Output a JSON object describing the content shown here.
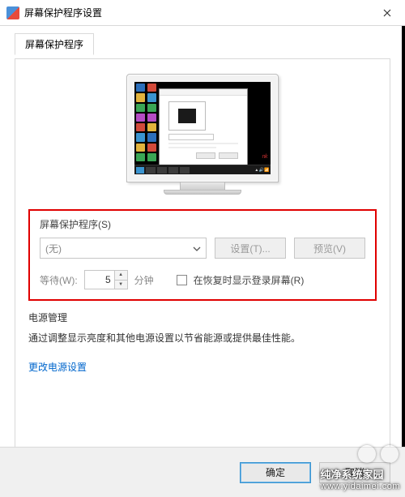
{
  "window": {
    "title": "屏幕保护程序设置"
  },
  "tab": {
    "label": "屏幕保护程序"
  },
  "screensaver": {
    "group_label": "屏幕保护程序(S)",
    "selected": "(无)",
    "settings_btn": "设置(T)...",
    "preview_btn": "预览(V)",
    "wait_label": "等待(W):",
    "wait_value": "5",
    "wait_unit": "分钟",
    "resume_checkbox": "在恢复时显示登录屏幕(R)"
  },
  "power": {
    "group_label": "电源管理",
    "desc": "通过调整显示亮度和其他电源设置以节省能源或提供最佳性能。",
    "link": "更改电源设置"
  },
  "footer": {
    "ok": "确定",
    "cancel": "取消"
  },
  "watermark": {
    "line1": "纯净系统家园",
    "line2": "www.yidaimei.com"
  }
}
